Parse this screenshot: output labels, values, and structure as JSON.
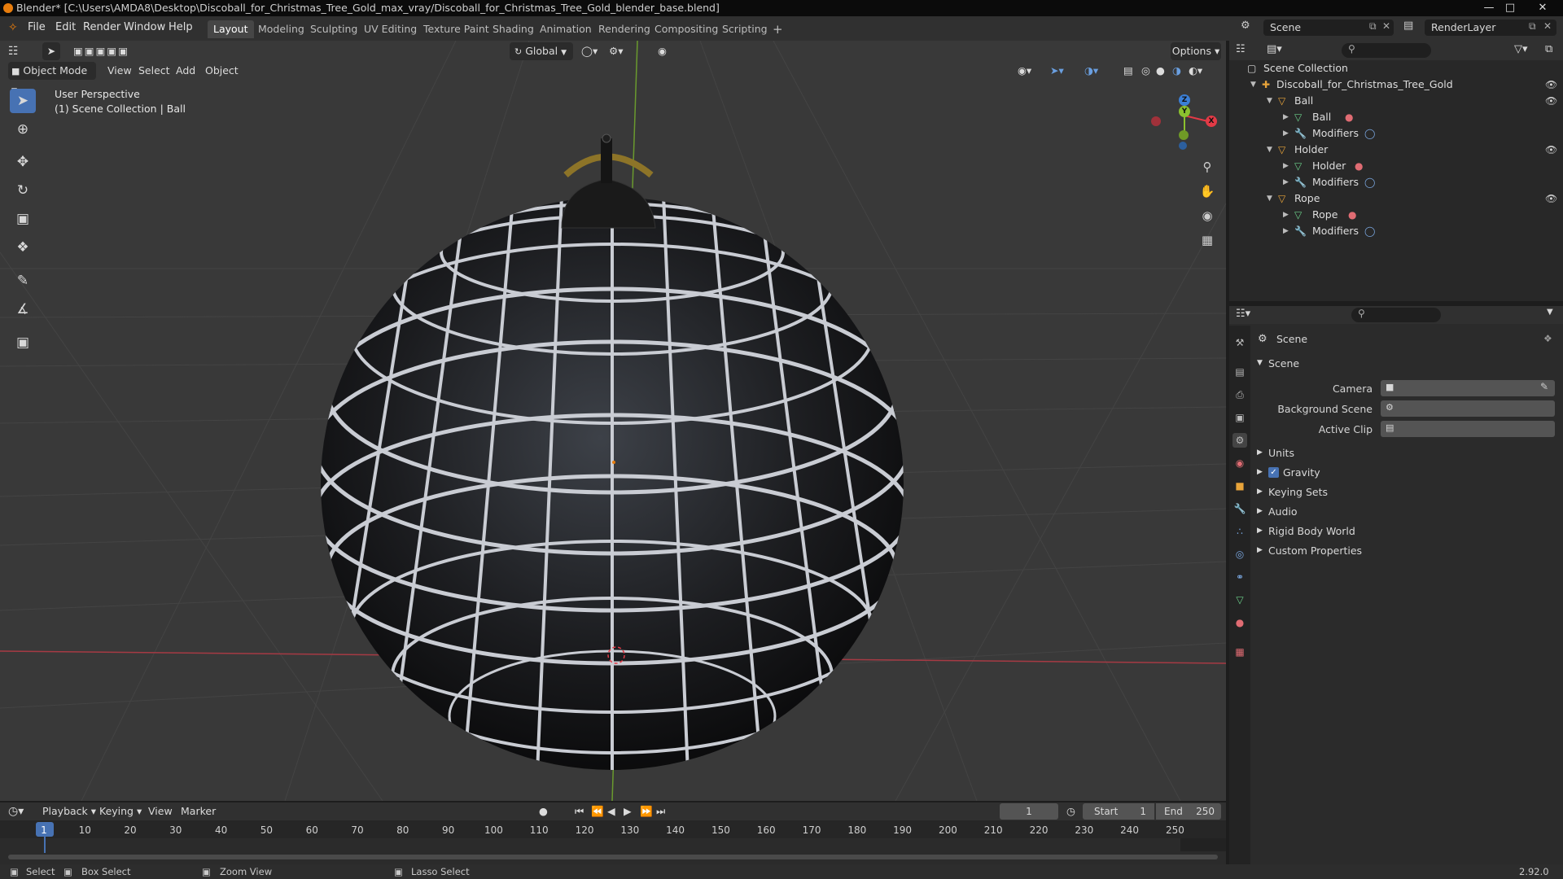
{
  "window": {
    "title": "Blender* [C:\\Users\\AMDA8\\Desktop\\Discoball_for_Christmas_Tree_Gold_max_vray/Discoball_for_Christmas_Tree_Gold_blender_base.blend]"
  },
  "menubar": {
    "items": [
      "File",
      "Edit",
      "Render",
      "Window",
      "Help"
    ],
    "workspaces": [
      "Layout",
      "Modeling",
      "Sculpting",
      "UV Editing",
      "Texture Paint",
      "Shading",
      "Animation",
      "Rendering",
      "Compositing",
      "Scripting"
    ],
    "active_workspace": "Layout",
    "add_tab": "+",
    "scene_name": "Scene",
    "render_layer": "RenderLayer"
  },
  "viewport_header": {
    "mode": "Object Mode",
    "menus": [
      "View",
      "Select",
      "Add",
      "Object"
    ],
    "transform_orientation": "Global",
    "options_label": "Options"
  },
  "viewport": {
    "perspective_label": "User Perspective",
    "collection_label": "(1) Scene Collection | Ball",
    "gizmo_axes": [
      "Z",
      "Y",
      "X"
    ],
    "tools": [
      "select-box-icon",
      "cursor-icon",
      "move-icon",
      "rotate-icon",
      "scale-icon",
      "transform-icon",
      "annotate-icon",
      "measure-icon",
      "add-cube-icon"
    ]
  },
  "outliner": {
    "root": "Scene Collection",
    "collection": "Discoball_for_Christmas_Tree_Gold",
    "objects": [
      {
        "name": "Ball",
        "mesh": "Ball",
        "modifiers": "Modifiers"
      },
      {
        "name": "Holder",
        "mesh": "Holder",
        "modifiers": "Modifiers"
      },
      {
        "name": "Rope",
        "mesh": "Rope",
        "modifiers": "Modifiers"
      }
    ]
  },
  "properties": {
    "context": "Scene",
    "panel": "Scene",
    "fields": [
      {
        "label": "Camera",
        "value": ""
      },
      {
        "label": "Background Scene",
        "value": ""
      },
      {
        "label": "Active Clip",
        "value": ""
      }
    ],
    "sections": [
      "Units",
      "Gravity",
      "Keying Sets",
      "Audio",
      "Rigid Body World",
      "Custom Properties"
    ],
    "gravity_checked": true
  },
  "timeline": {
    "menus": [
      "Playback",
      "Keying",
      "View",
      "Marker"
    ],
    "current_frame": "1",
    "start_label": "Start",
    "start": "1",
    "end_label": "End",
    "end": "250",
    "ruler": [
      "1",
      "10",
      "20",
      "30",
      "40",
      "50",
      "60",
      "70",
      "80",
      "90",
      "100",
      "110",
      "120",
      "130",
      "140",
      "150",
      "160",
      "170",
      "180",
      "190",
      "200",
      "210",
      "220",
      "230",
      "240",
      "250"
    ]
  },
  "statusbar": {
    "select": "Select",
    "box_select": "Box Select",
    "zoom_view": "Zoom View",
    "lasso_select": "Lasso Select",
    "version": "2.92.0"
  },
  "colors": {
    "accent": "#4772b3",
    "x_axis": "#e23a46",
    "y_axis": "#8bc12e",
    "z_axis": "#3b7fd6",
    "brand": "#e87d0d"
  }
}
